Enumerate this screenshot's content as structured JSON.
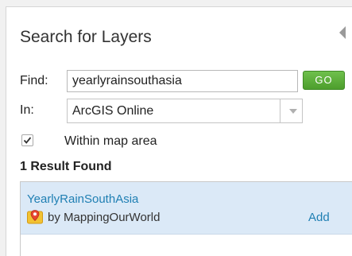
{
  "panel": {
    "title": "Search for Layers"
  },
  "search": {
    "find_label": "Find:",
    "find_value": "yearlyrainsouthasia",
    "go_label": "GO",
    "in_label": "In:",
    "in_selected": "ArcGIS Online",
    "within_map_label": "Within map area",
    "within_map_checked": true
  },
  "results": {
    "count_text": "1 Result Found",
    "items": [
      {
        "title": "YearlyRainSouthAsia",
        "owner": "by MappingOurWorld",
        "icon": "map-layer-icon",
        "add_label": "Add"
      }
    ]
  },
  "colors": {
    "link": "#1f7fb3",
    "go_button": "#5aae38",
    "selected_row": "#dbe9f7"
  }
}
